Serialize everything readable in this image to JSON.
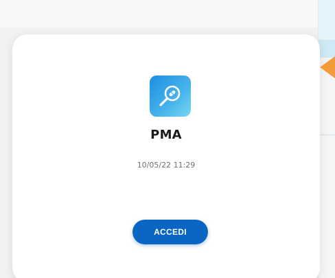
{
  "card": {
    "app_name": "PMA",
    "timestamp": "10/05/22 11:29",
    "action_label": "ACCEDI"
  },
  "icons": {
    "app": "magnifier-pill-icon",
    "pointer": "orange-arrow-pointer"
  },
  "colors": {
    "button": "#0b66c3",
    "icon_gradient_start": "#1e8ee4",
    "icon_gradient_end": "#79d5f0",
    "pointer": "#f39a3a"
  }
}
